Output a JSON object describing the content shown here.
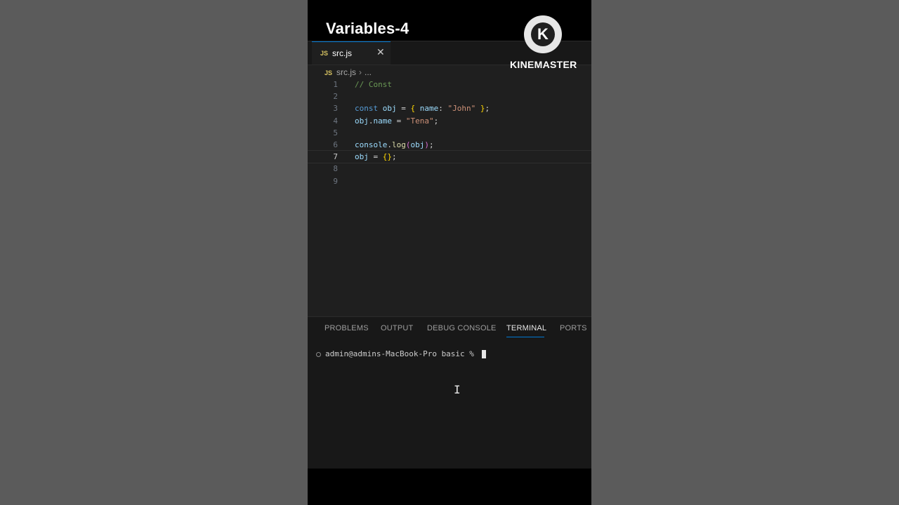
{
  "video": {
    "title": "Variables-4"
  },
  "watermark": {
    "logo_letter": "K",
    "text": "KINEMASTER"
  },
  "editor": {
    "tab": {
      "icon": "JS",
      "label": "src.js",
      "close": "✕"
    },
    "breadcrumb": {
      "icon": "JS",
      "file": "src.js",
      "separator": "›",
      "more": "..."
    },
    "lines": [
      {
        "n": "1",
        "code": "// Const"
      },
      {
        "n": "2",
        "code": ""
      },
      {
        "n": "3",
        "code": "const obj = { name: \"John\" };"
      },
      {
        "n": "4",
        "code": "obj.name = \"Tena\";"
      },
      {
        "n": "5",
        "code": ""
      },
      {
        "n": "6",
        "code": "console.log(obj);"
      },
      {
        "n": "7",
        "code": "obj = {};"
      },
      {
        "n": "8",
        "code": ""
      },
      {
        "n": "9",
        "code": ""
      }
    ],
    "active_line": "7"
  },
  "panel": {
    "tabs": [
      "PROBLEMS",
      "OUTPUT",
      "DEBUG CONSOLE",
      "TERMINAL",
      "PORTS"
    ],
    "active_tab": "TERMINAL",
    "terminal_prompt": "admin@admins-MacBook-Pro basic % "
  },
  "colors": {
    "accent": "#0078d4",
    "editor_bg": "#1f1f1f",
    "panel_bg": "#181818",
    "comment": "#6a9955",
    "keyword": "#569cd6",
    "string": "#ce9178"
  }
}
